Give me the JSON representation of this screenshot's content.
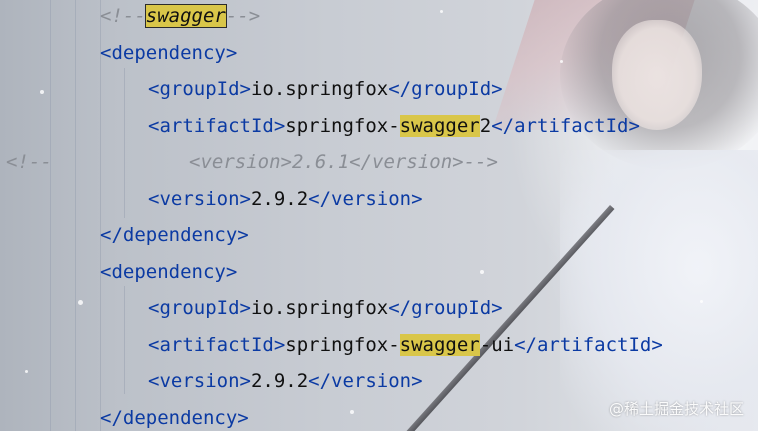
{
  "editor": {
    "lines": [
      {
        "indent": "    ",
        "parts": [
          {
            "t": "<!--",
            "c": "comment"
          },
          {
            "t": "swagger",
            "c": "comment hl-box"
          },
          {
            "t": "-->",
            "c": "comment"
          }
        ]
      },
      {
        "indent": "    ",
        "parts": [
          {
            "t": "<dependency>",
            "c": "tag"
          }
        ]
      },
      {
        "indent": "      ",
        "parts": [
          {
            "t": "<groupId>",
            "c": "tag"
          },
          {
            "t": "io.springfox",
            "c": "text"
          },
          {
            "t": "</groupId>",
            "c": "tag"
          }
        ]
      },
      {
        "indent": "      ",
        "parts": [
          {
            "t": "<artifactId>",
            "c": "tag"
          },
          {
            "t": "springfox-",
            "c": "text"
          },
          {
            "t": "swagger",
            "c": "text hl"
          },
          {
            "t": "2",
            "c": "text"
          },
          {
            "t": "</artifactId>",
            "c": "tag"
          }
        ]
      },
      {
        "indent": "",
        "parts": [
          {
            "t": "<!--",
            "c": "comment"
          },
          {
            "t": "            <version>2.6.1</version>-->",
            "c": "comment"
          }
        ]
      },
      {
        "indent": "      ",
        "parts": [
          {
            "t": "<version>",
            "c": "tag"
          },
          {
            "t": "2.9.2",
            "c": "text"
          },
          {
            "t": "</version>",
            "c": "tag"
          }
        ]
      },
      {
        "indent": "    ",
        "parts": [
          {
            "t": "</dependency>",
            "c": "tag"
          }
        ]
      },
      {
        "indent": "    ",
        "parts": [
          {
            "t": "<dependency>",
            "c": "tag"
          }
        ]
      },
      {
        "indent": "      ",
        "parts": [
          {
            "t": "<groupId>",
            "c": "tag"
          },
          {
            "t": "io.springfox",
            "c": "text"
          },
          {
            "t": "</groupId>",
            "c": "tag"
          }
        ]
      },
      {
        "indent": "      ",
        "parts": [
          {
            "t": "<artifactId>",
            "c": "tag"
          },
          {
            "t": "springfox-",
            "c": "text"
          },
          {
            "t": "swagger",
            "c": "text hl"
          },
          {
            "t": "-ui",
            "c": "text"
          },
          {
            "t": "</artifactId>",
            "c": "tag"
          }
        ]
      },
      {
        "indent": "      ",
        "parts": [
          {
            "t": "<version>",
            "c": "tag"
          },
          {
            "t": "2.9.2",
            "c": "text"
          },
          {
            "t": "</version>",
            "c": "tag"
          }
        ]
      },
      {
        "indent": "    ",
        "parts": [
          {
            "t": "</dependency>",
            "c": "tag"
          }
        ]
      }
    ]
  },
  "watermark": {
    "text": "@稀土掘金技术社区"
  }
}
